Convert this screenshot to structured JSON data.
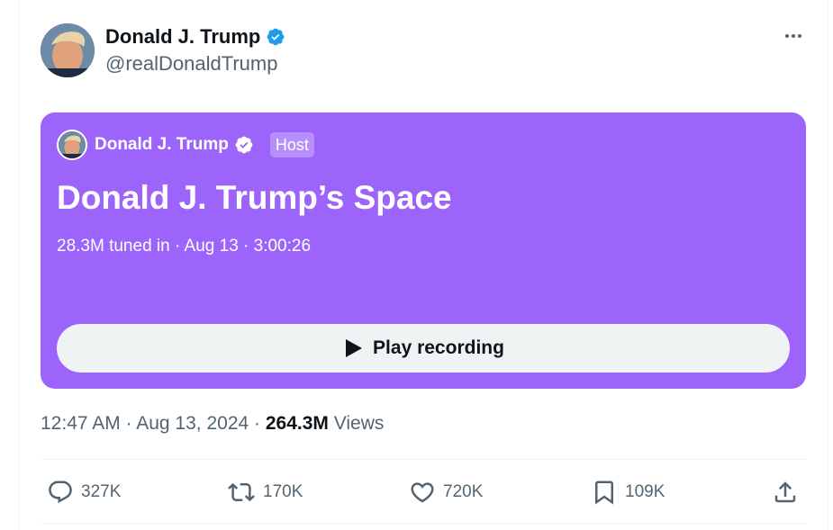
{
  "author": {
    "display_name": "Donald J. Trump",
    "handle": "@realDonaldTrump",
    "verified": true,
    "avatar_icon": "profile-photo"
  },
  "space": {
    "host_name": "Donald J. Trump",
    "host_badge": "Host",
    "title": "Donald J. Trump’s Space",
    "meta": "28.3M tuned in · Aug 13 · 3:00:26",
    "play_label": "Play recording",
    "background_color": "#9c64fb"
  },
  "post_time": {
    "date": "12:47 AM · Aug 13, 2024 · ",
    "views_count": "264.3M",
    "views_label": " Views"
  },
  "actions": {
    "replies": "327K",
    "reposts": "170K",
    "likes": "720K",
    "bookmarks": "109K"
  },
  "colors": {
    "verified_badge": "#1d9bf0",
    "secondary_text": "#536471",
    "primary_text": "#0f1419"
  }
}
